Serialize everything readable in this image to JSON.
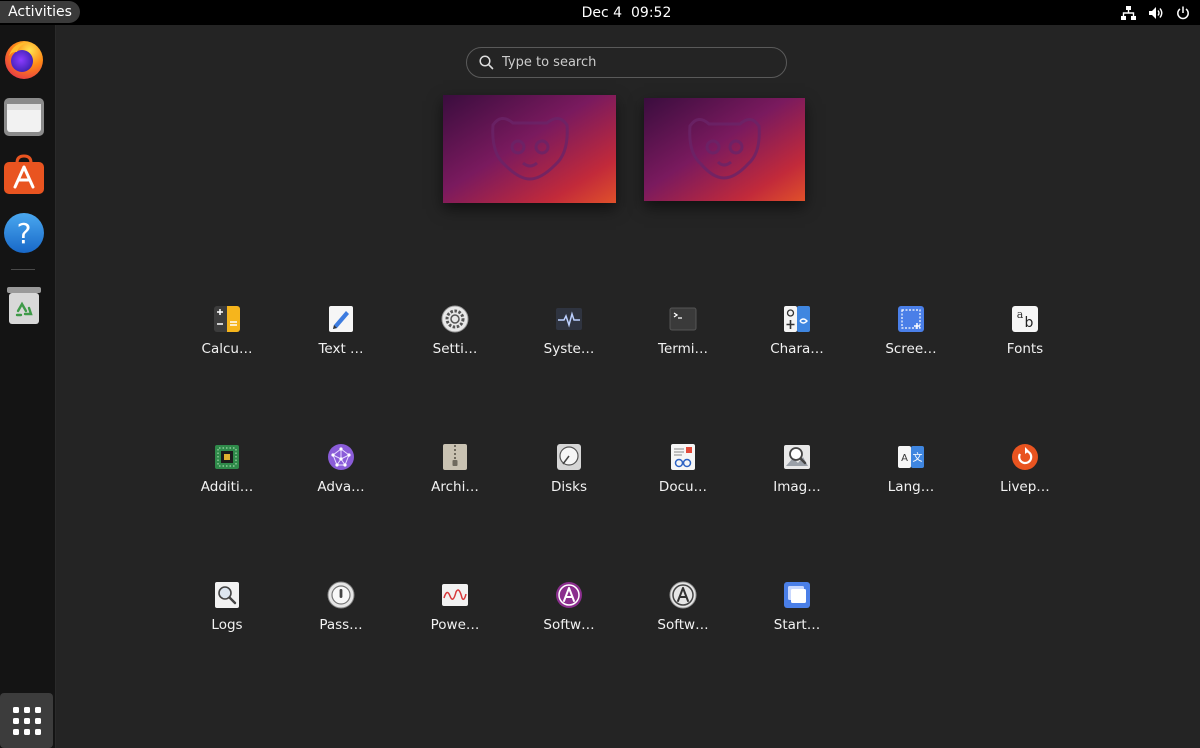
{
  "topbar": {
    "activities": "Activities",
    "date": "Dec 4",
    "time": "09:52"
  },
  "search": {
    "placeholder": "Type to search"
  },
  "dock": {
    "apps": [
      {
        "icon": "firefox-icon"
      },
      {
        "icon": "files-icon"
      },
      {
        "icon": "app-center-icon"
      },
      {
        "icon": "help-icon"
      },
      {
        "icon": "trash-icon"
      }
    ],
    "show_apps_icon": "grid-icon"
  },
  "apps": [
    {
      "label": "Calcu…",
      "icon": "calculator-icon"
    },
    {
      "label": "Text …",
      "icon": "text-editor-icon"
    },
    {
      "label": "Setti…",
      "icon": "settings-icon"
    },
    {
      "label": "Syste…",
      "icon": "system-monitor-icon"
    },
    {
      "label": "Termi…",
      "icon": "terminal-icon"
    },
    {
      "label": "Chara…",
      "icon": "characters-icon"
    },
    {
      "label": "Scree…",
      "icon": "screenshot-icon"
    },
    {
      "label": "Fonts",
      "icon": "fonts-icon"
    },
    {
      "label": "Additi…",
      "icon": "additional-drivers-icon"
    },
    {
      "label": "Adva…",
      "icon": "advanced-network-icon"
    },
    {
      "label": "Archi…",
      "icon": "archive-manager-icon"
    },
    {
      "label": "Disks",
      "icon": "disks-icon"
    },
    {
      "label": "Docu…",
      "icon": "document-viewer-icon"
    },
    {
      "label": "Imag…",
      "icon": "image-viewer-icon"
    },
    {
      "label": "Lang…",
      "icon": "language-support-icon"
    },
    {
      "label": "Livep…",
      "icon": "livepatch-icon"
    },
    {
      "label": "Logs",
      "icon": "logs-icon"
    },
    {
      "label": "Pass…",
      "icon": "passwords-icon"
    },
    {
      "label": "Powe…",
      "icon": "power-statistics-icon"
    },
    {
      "label": "Softw…",
      "icon": "software-updater-icon"
    },
    {
      "label": "Softw…",
      "icon": "software-properties-icon"
    },
    {
      "label": "Start…",
      "icon": "startup-disk-icon"
    }
  ],
  "colors": {
    "accent": "#e95420",
    "background": "#242424",
    "topbar": "#000000",
    "dock": "#141414"
  }
}
